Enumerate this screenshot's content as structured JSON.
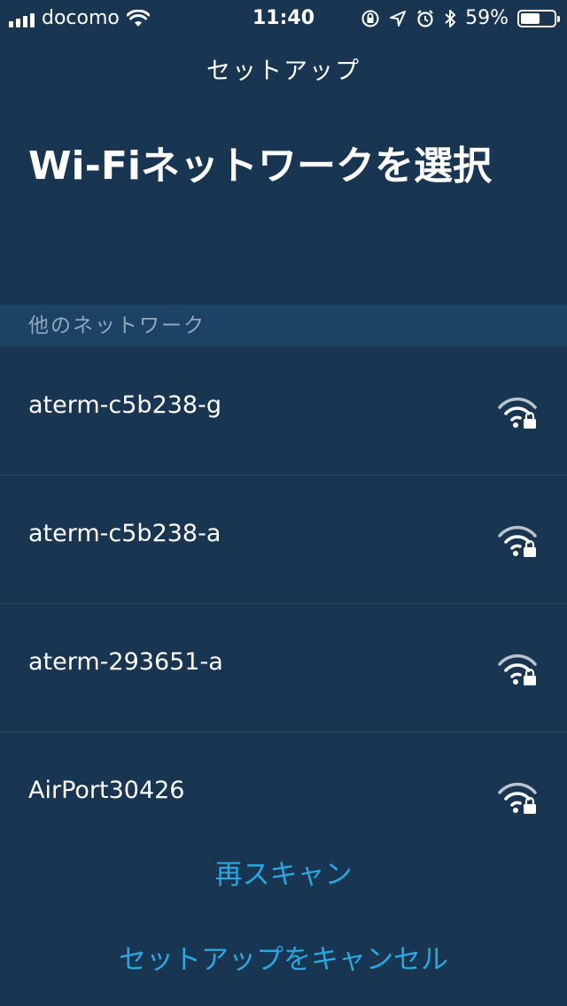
{
  "status_bar": {
    "carrier": "docomo",
    "time": "11:40",
    "battery_percent": "59%",
    "battery_level": 0.59,
    "icons": [
      "signal-icon",
      "wifi-icon",
      "orientation-lock-icon",
      "location-icon",
      "alarm-icon",
      "bluetooth-icon",
      "battery-icon"
    ]
  },
  "nav": {
    "title": "セットアップ"
  },
  "page": {
    "title": "Wi-Fiネットワークを選択"
  },
  "section": {
    "header": "他のネットワーク"
  },
  "networks": [
    {
      "name": "aterm-c5b238-g",
      "icon": "wifi-lock-icon"
    },
    {
      "name": "aterm-c5b238-a",
      "icon": "wifi-lock-icon"
    },
    {
      "name": "aterm-293651-a",
      "icon": "wifi-lock-icon"
    },
    {
      "name": "AirPort30426",
      "icon": "wifi-lock-icon"
    }
  ],
  "actions": {
    "rescan": "再スキャン",
    "cancel_setup": "セットアップをキャンセル"
  },
  "colors": {
    "background": "#183551",
    "section_header_bg": "#1c4264",
    "link": "#29a8e0",
    "divider": "#2a4760"
  }
}
